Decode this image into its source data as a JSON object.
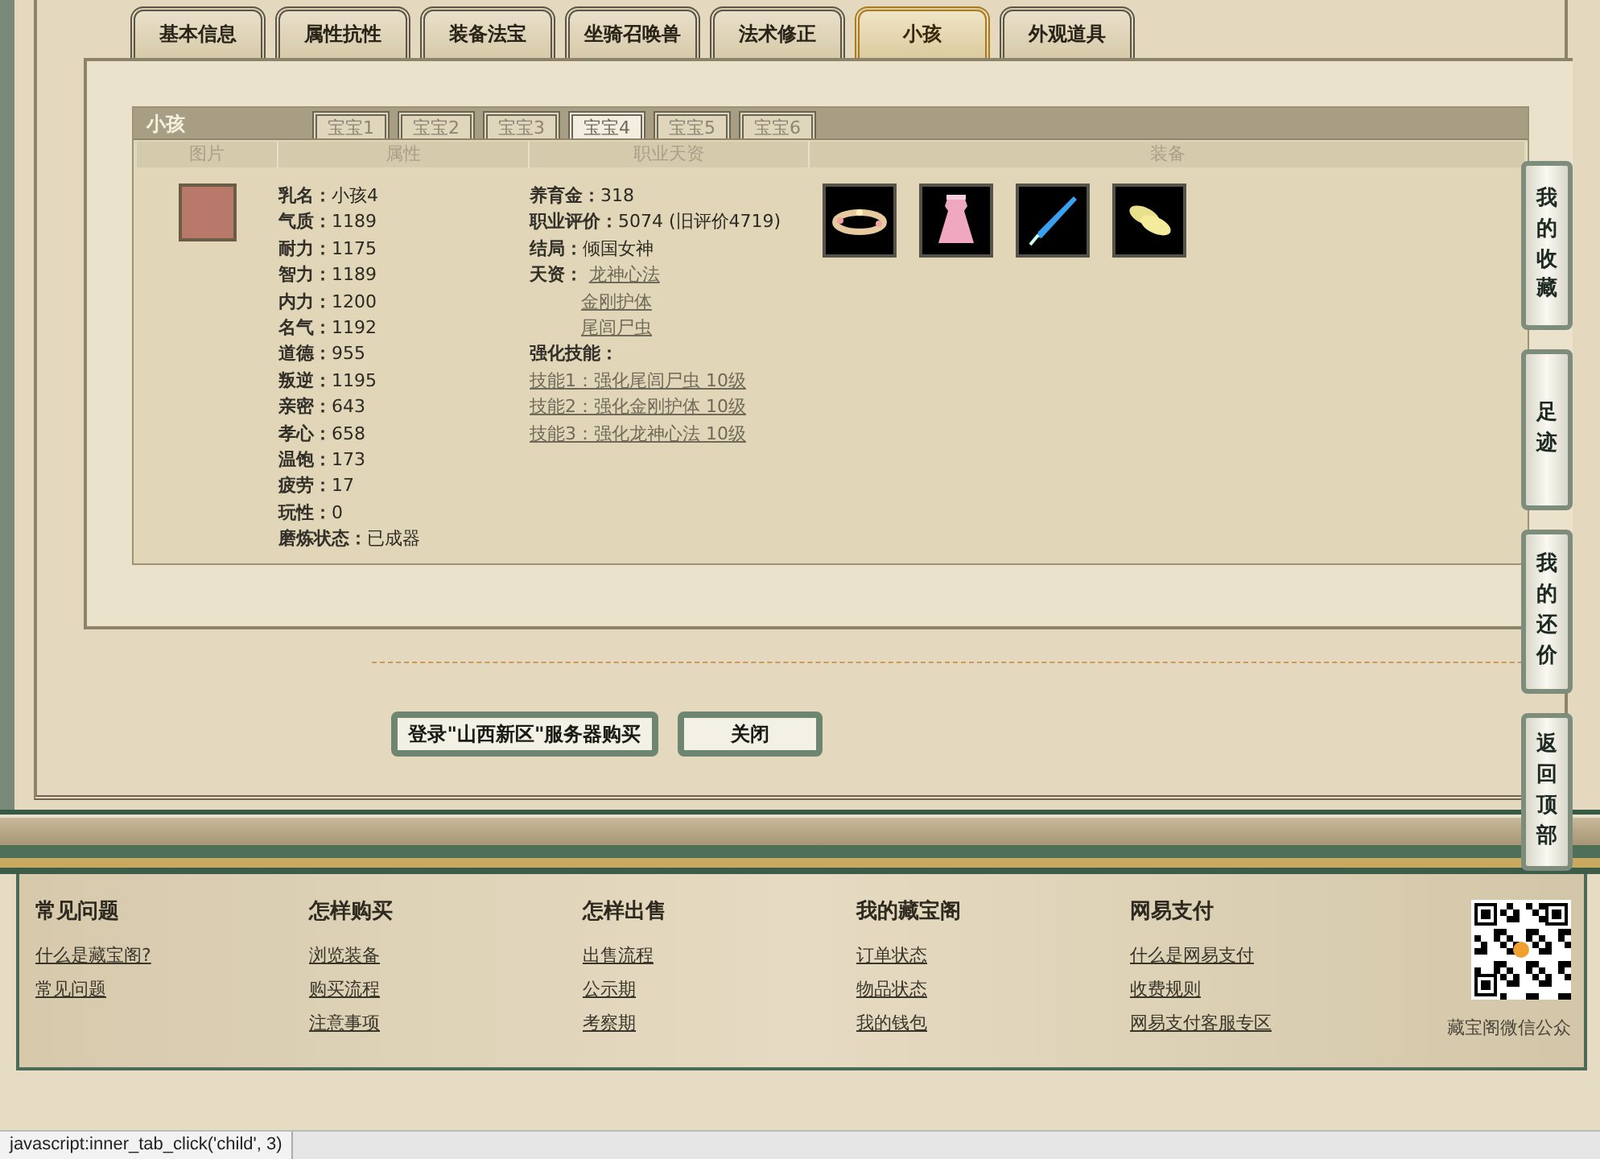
{
  "main_tabs": [
    {
      "label": "基本信息",
      "selected": false
    },
    {
      "label": "属性抗性",
      "selected": false
    },
    {
      "label": "装备法宝",
      "selected": false
    },
    {
      "label": "坐骑召唤兽",
      "selected": false
    },
    {
      "label": "法术修正",
      "selected": false
    },
    {
      "label": "小孩",
      "selected": true
    },
    {
      "label": "外观道具",
      "selected": false
    }
  ],
  "child_panel": {
    "title": "小孩",
    "baby_tabs": [
      {
        "label": "宝宝1",
        "selected": false
      },
      {
        "label": "宝宝2",
        "selected": false
      },
      {
        "label": "宝宝3",
        "selected": false
      },
      {
        "label": "宝宝4",
        "selected": true
      },
      {
        "label": "宝宝5",
        "selected": false
      },
      {
        "label": "宝宝6",
        "selected": false
      }
    ],
    "columns": [
      "图片",
      "属性",
      "职业天资",
      "装备"
    ],
    "attributes": [
      {
        "label": "乳名：",
        "value": "小孩4"
      },
      {
        "label": "气质：",
        "value": "1189"
      },
      {
        "label": "耐力：",
        "value": "1175"
      },
      {
        "label": "智力：",
        "value": "1189"
      },
      {
        "label": "内力：",
        "value": "1200"
      },
      {
        "label": "名气：",
        "value": "1192"
      },
      {
        "label": "道德：",
        "value": "955"
      },
      {
        "label": "叛逆：",
        "value": "1195"
      },
      {
        "label": "亲密：",
        "value": "643"
      },
      {
        "label": "孝心：",
        "value": "658"
      },
      {
        "label": "温饱：",
        "value": "173"
      },
      {
        "label": "疲劳：",
        "value": "17"
      },
      {
        "label": "玩性：",
        "value": "0"
      },
      {
        "label": "磨炼状态：",
        "value": "已成器"
      }
    ],
    "career": [
      {
        "label": "养育金：",
        "value": "318"
      },
      {
        "label": "职业评价：",
        "value": "5074 (旧评价4719)"
      },
      {
        "label": "结局：",
        "value": "倾国女神"
      }
    ],
    "talent_label": "天资：",
    "talents": [
      "龙神心法",
      "金刚护体",
      "尾闾尸虫"
    ],
    "skills_label": "强化技能：",
    "skills": [
      "技能1：强化尾闾尸虫 10级",
      "技能2：强化金刚护体 10级",
      "技能3：强化龙神心法 10级"
    ],
    "equipment": [
      {
        "kind": "wreath"
      },
      {
        "kind": "dress"
      },
      {
        "kind": "sword"
      },
      {
        "kind": "shoes"
      }
    ]
  },
  "actions": [
    "登录\"山西新区\"服务器购买",
    "关闭"
  ],
  "side_buttons": [
    "我的收藏",
    "足迹",
    "我的还价",
    "返回顶部"
  ],
  "footer": {
    "columns": [
      {
        "title": "常见问题",
        "links": [
          "什么是藏宝阁?",
          "常见问题"
        ]
      },
      {
        "title": "怎样购买",
        "links": [
          "浏览装备",
          "购买流程",
          "注意事项"
        ]
      },
      {
        "title": "怎样出售",
        "links": [
          "出售流程",
          "公示期",
          "考察期"
        ]
      },
      {
        "title": "我的藏宝阁",
        "links": [
          "订单状态",
          "物品状态",
          "我的钱包"
        ]
      },
      {
        "title": "网易支付",
        "links": [
          "什么是网易支付",
          "收费规则",
          "网易支付客服专区"
        ]
      }
    ],
    "qr_caption": "藏宝阁微信公众"
  },
  "status_bar": "javascript:inner_tab_click('child', 3)"
}
